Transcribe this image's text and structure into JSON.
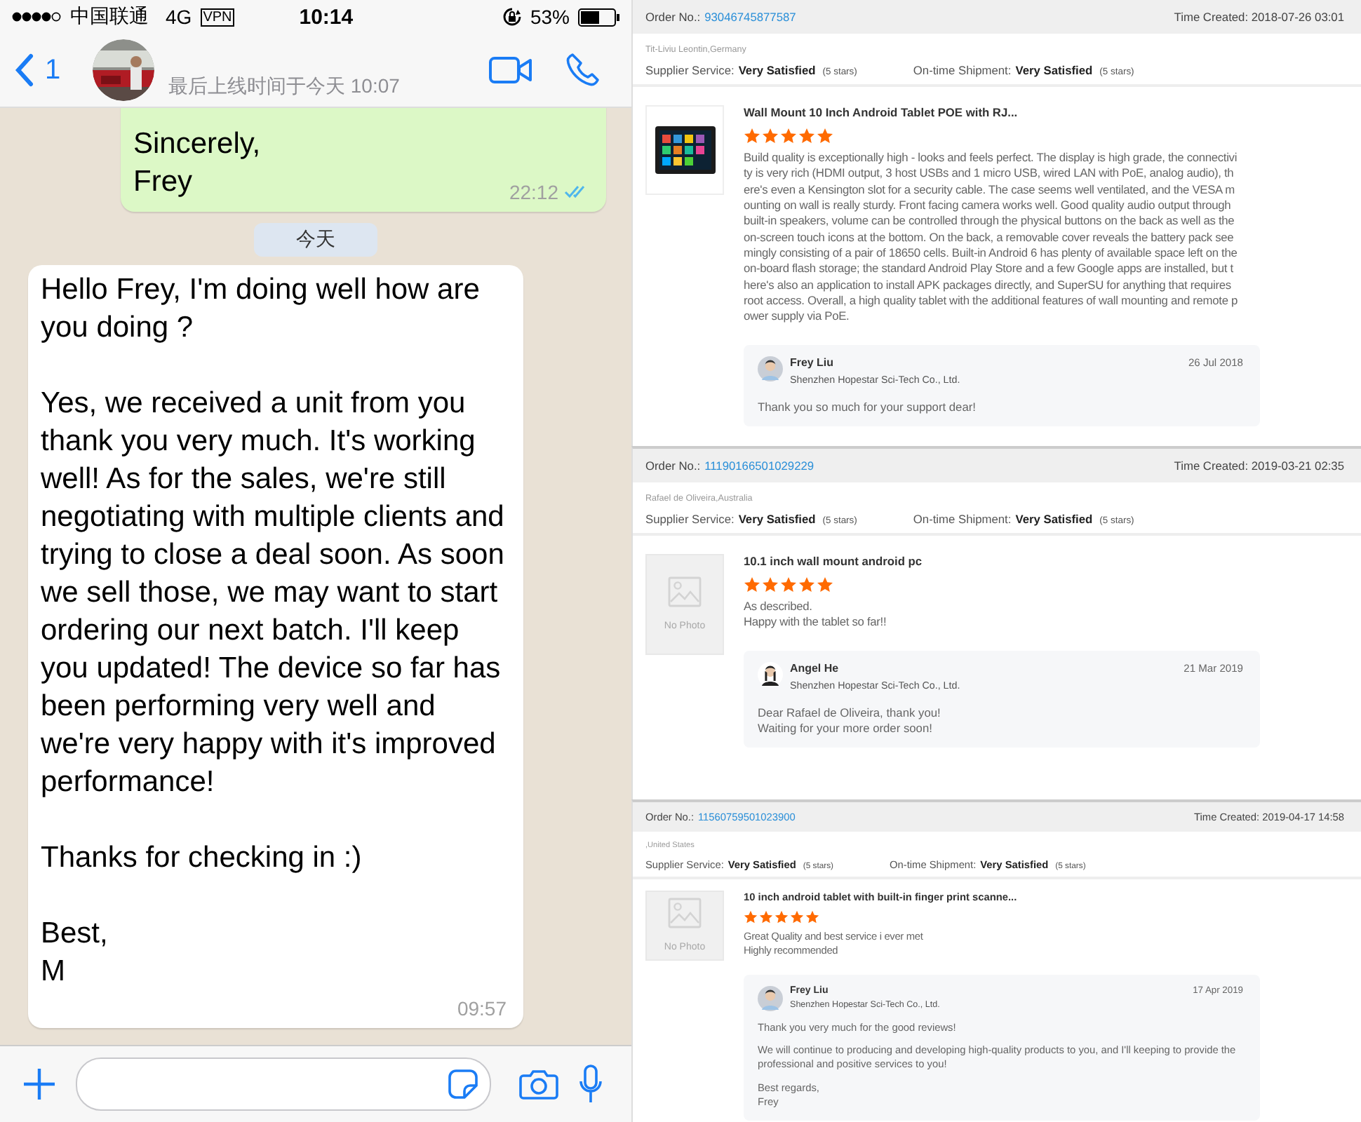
{
  "status_bar": {
    "carrier": "中国联通",
    "network": "4G",
    "vpn": "VPN",
    "time": "10:14",
    "battery": "53%"
  },
  "chat_header": {
    "back_count": "1",
    "last_seen": "最后上线时间于今天 10:07"
  },
  "messages": [
    {
      "kind": "outgoing",
      "paragraphs": [
        "Sincerely,\nFrey"
      ],
      "time": "22:12",
      "read": true
    },
    {
      "kind": "date",
      "text": "今天"
    },
    {
      "kind": "incoming",
      "paragraphs": [
        "Hello Frey, I'm doing well how are you doing ?",
        "Yes, we received a unit from you thank you very much. It's working well! As for the sales, we're still negotiating with multiple clients and trying to close a deal soon. As soon we sell those, we may want to start ordering our next batch. I'll keep you updated! The device so far has been performing very well and we're very happy with it's improved performance!",
        "Thanks for checking in :)",
        "Best,\nM"
      ],
      "time": "09:57"
    }
  ],
  "reviews": [
    {
      "order_label": "Order No.:",
      "order_no": "93046745877587",
      "time_created": "Time Created: 2018-07-26 03:01",
      "buyer": "Tit-Liviu Leontin,Germany",
      "ratings": [
        {
          "label": "Supplier Service:",
          "value": "Very Satisfied",
          "note": "(5 stars)"
        },
        {
          "label": "On-time Shipment:",
          "value": "Very Satisfied",
          "note": "(5 stars)"
        }
      ],
      "product": {
        "title": "Wall Mount 10 Inch Android Tablet POE with RJ...",
        "stars": 5,
        "text": "Build quality is exceptionally high - looks and feels perfect. The display is high grade, the connectivity is very rich (HDMI output, 3 host USBs and 1 micro USB, wired LAN with PoE, analog audio), there's even a Kensington slot for a security cable. The case seems well ventilated, and the VESA mounting on wall is really sturdy. Front facing camera works well. Good quality audio output through built-in speakers, volume can be controlled through the physical buttons on the back as well as the on-screen touch icons at the bottom. On the back, a removable cover reveals the battery pack seemingly consisting of a pair of 18650 cells. Built-in Android 6 has plenty of available space left on the on-board flash storage; the standard Android Play Store and a few Google apps are installed, but there's also an application to install APK packages directly, and SuperSU for anything that requires root access. Overall, a high quality tablet with the additional features of wall mounting and remote power supply via PoE."
      },
      "reply": {
        "name": "Frey Liu",
        "company": "Shenzhen Hopestar Sci-Tech Co., Ltd.",
        "date": "26 Jul 2018",
        "paragraphs": [
          "Thank you so much for your support dear!"
        ]
      }
    },
    {
      "order_label": "Order No.:",
      "order_no": "11190166501029229",
      "time_created": "Time Created: 2019-03-21 02:35",
      "buyer": "Rafael de Oliveira,Australia",
      "ratings": [
        {
          "label": "Supplier Service:",
          "value": "Very Satisfied",
          "note": "(5 stars)"
        },
        {
          "label": "On-time Shipment:",
          "value": "Very Satisfied",
          "note": "(5 stars)"
        }
      ],
      "product": {
        "image": {
          "kind": "none",
          "label": "No Photo"
        },
        "title": "10.1 inch wall mount android pc",
        "stars": 5,
        "text": "As described.\nHappy with the tablet so far!!"
      },
      "reply": {
        "name": "Angel He",
        "company": "Shenzhen Hopestar Sci-Tech Co., Ltd.",
        "date": "21 Mar 2019",
        "paragraphs": [
          "Dear Rafael de Oliveira, thank you!\nWaiting for your more order soon!"
        ]
      }
    },
    {
      "order_label": "Order No.:",
      "order_no": "11560759501023900",
      "time_created": "Time Created: 2019-04-17 14:58",
      "buyer": ",United States",
      "ratings": [
        {
          "label": "Supplier Service:",
          "value": "Very Satisfied",
          "note": "(5 stars)"
        },
        {
          "label": "On-time Shipment:",
          "value": "Very Satisfied",
          "note": "(5 stars)"
        }
      ],
      "product": {
        "image": {
          "kind": "none",
          "label": "No Photo"
        },
        "title": "10 inch android tablet with built-in finger print scanne...",
        "stars": 5,
        "text": "Great Quality and best service i ever met\nHighly recommended"
      },
      "reply": {
        "name": "Frey Liu",
        "company": "Shenzhen Hopestar Sci-Tech Co., Ltd.",
        "date": "17 Apr 2019",
        "paragraphs": [
          "Thank you very much for the good reviews!",
          "We will continue to producing and developing high-quality products to you, and I'll keeping to provide the professional and positive services to you!",
          "Best regards,\nFrey"
        ]
      }
    }
  ]
}
